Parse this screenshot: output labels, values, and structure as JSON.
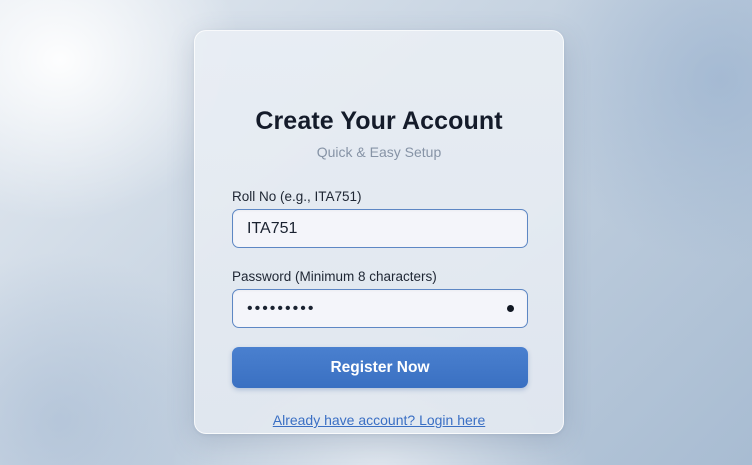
{
  "form": {
    "title": "Create Your Account",
    "subtitle": "Quick & Easy Setup",
    "roll_label": "Roll No (e.g., ITA751)",
    "roll_value": "ITA751",
    "password_label": "Password (Minimum 8 characters)",
    "password_value": "•••••••••",
    "submit_label": "Register Now",
    "login_link": "Already have account? Login here"
  },
  "colors": {
    "accent": "#3a70c2",
    "input_border": "#5d87c4",
    "title": "#141b2a",
    "subtitle": "#8693a6"
  },
  "icons": {
    "password_toggle": "visibility-dot-icon"
  }
}
